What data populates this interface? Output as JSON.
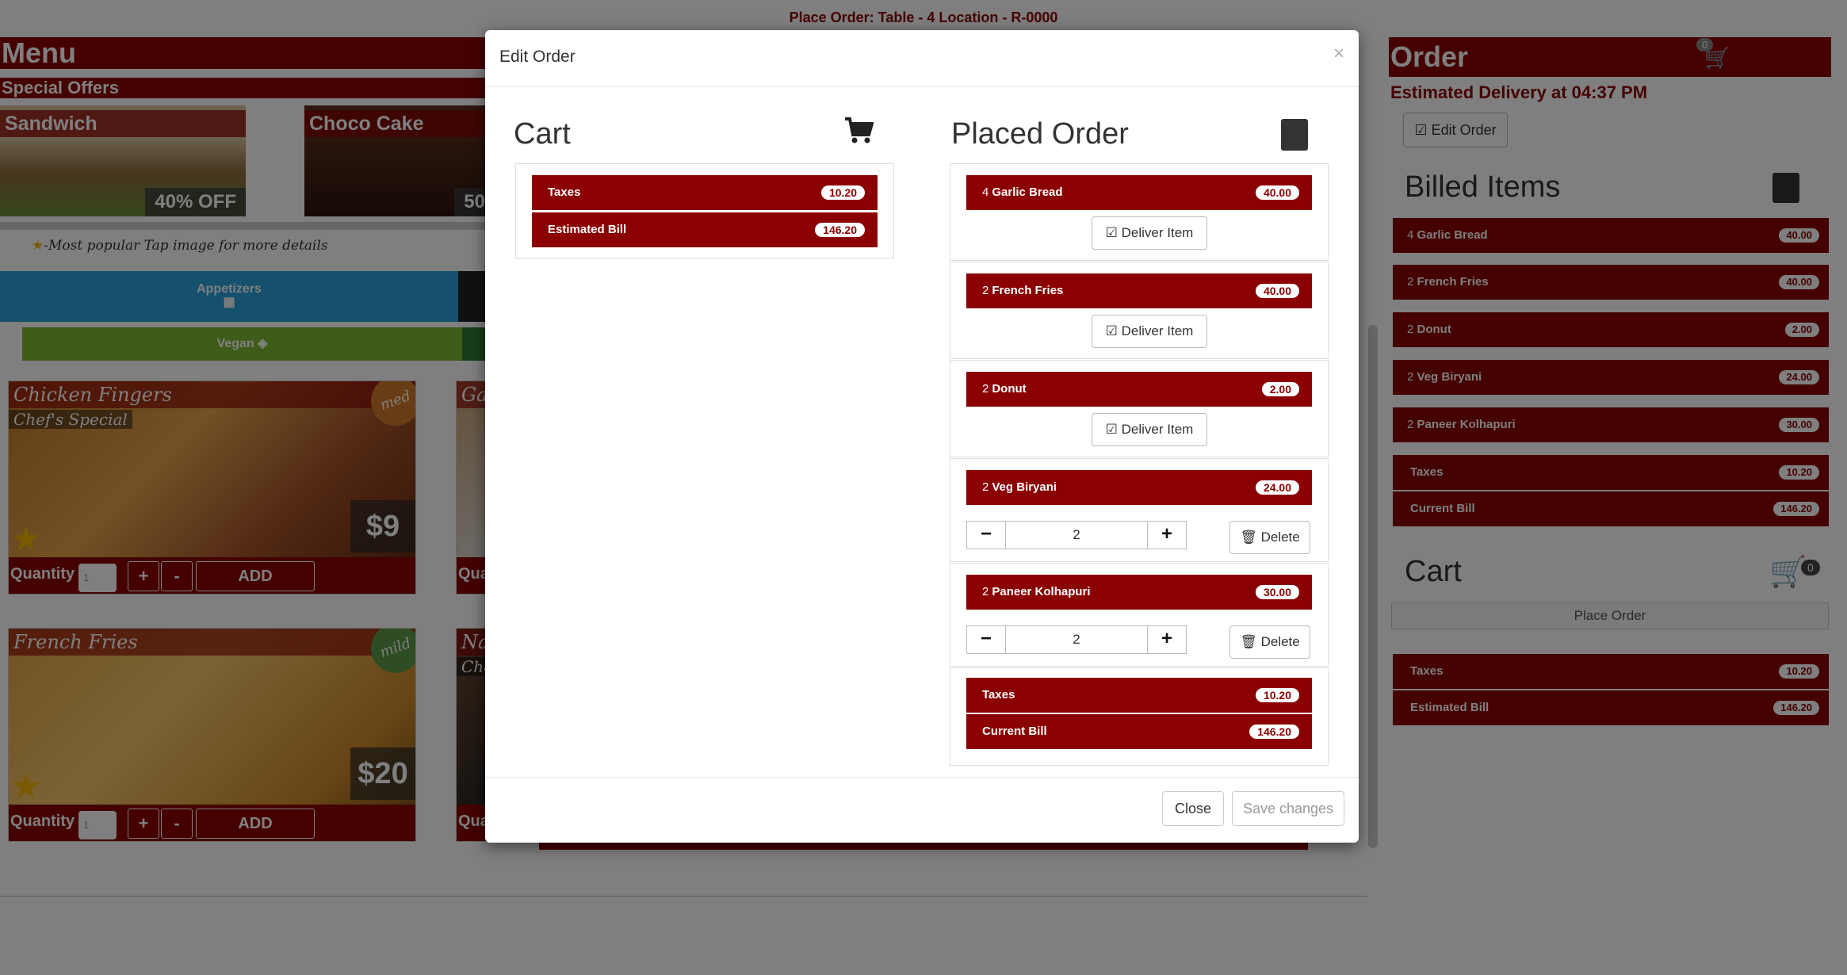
{
  "page": {
    "top_title": "Place Order: Table - 4 Location - R-0000"
  },
  "menu": {
    "title": "Menu",
    "special_offers_label": "Special Offers",
    "offers": [
      {
        "name": "Sandwich",
        "discount": "40% OFF"
      },
      {
        "name": "Choco Cake",
        "discount": "50"
      }
    ],
    "hint": "-Most popular   Tap image for more details",
    "category": "Appetizers",
    "filter": "Vegan",
    "items": [
      {
        "name": "Chicken Fingers",
        "subtitle": "Chef's Special",
        "price": "$9",
        "spice": "med",
        "qty_label": "Quantity",
        "qty_value": "1",
        "plus": "+",
        "minus": "-",
        "add": "ADD"
      },
      {
        "name": "French Fries",
        "subtitle": "",
        "price": "$20",
        "spice": "mild",
        "qty_label": "Quantity",
        "qty_value": "1",
        "plus": "+",
        "minus": "-",
        "add": "ADD"
      }
    ],
    "items_col2": [
      {
        "name": "Gar",
        "qty_label": "Qua"
      },
      {
        "name": "Na",
        "subtitle": "Chef",
        "qty_label": "Qua"
      }
    ]
  },
  "sidebar": {
    "title": "Order",
    "cart_count": "0",
    "estimated_delivery": "Estimated Delivery at 04:37 PM",
    "edit_order_label": "Edit Order",
    "billed_title": "Billed Items",
    "billed_items": [
      {
        "qty": "4",
        "name": "Garlic Bread",
        "amount": "40.00"
      },
      {
        "qty": "2",
        "name": "French Fries",
        "amount": "40.00"
      },
      {
        "qty": "2",
        "name": "Donut",
        "amount": "2.00"
      },
      {
        "qty": "2",
        "name": "Veg Biryani",
        "amount": "24.00"
      },
      {
        "qty": "2",
        "name": "Paneer Kolhapuri",
        "amount": "30.00"
      }
    ],
    "billed_totals": [
      {
        "label": "Taxes",
        "amount": "10.20"
      },
      {
        "label": "Current Bill",
        "amount": "146.20"
      }
    ],
    "cart_title": "Cart",
    "cart_badge": "0",
    "place_order_label": "Place Order",
    "cart_totals": [
      {
        "label": "Taxes",
        "amount": "10.20"
      },
      {
        "label": "Estimated Bill",
        "amount": "146.20"
      }
    ]
  },
  "modal": {
    "title": "Edit Order",
    "close_x": "×",
    "cart_title": "Cart",
    "placed_title": "Placed Order",
    "cart_rows": [
      {
        "label": "Taxes",
        "amount": "10.20"
      },
      {
        "label": "Estimated Bill",
        "amount": "146.20"
      }
    ],
    "placed_items": [
      {
        "qty": "4",
        "name": "Garlic Bread",
        "amount": "40.00",
        "action": "Deliver Item"
      },
      {
        "qty": "2",
        "name": "French Fries",
        "amount": "40.00",
        "action": "Deliver Item"
      },
      {
        "qty": "2",
        "name": "Donut",
        "amount": "2.00",
        "action": "Deliver Item"
      },
      {
        "qty": "2",
        "name": "Veg Biryani",
        "amount": "24.00",
        "minus": "−",
        "quantity": "2",
        "plus": "+",
        "delete": "Delete"
      },
      {
        "qty": "2",
        "name": "Paneer Kolhapuri",
        "amount": "30.00",
        "minus": "−",
        "quantity": "2",
        "plus": "+",
        "delete": "Delete"
      }
    ],
    "placed_totals": [
      {
        "label": "Taxes",
        "amount": "10.20"
      },
      {
        "label": "Current Bill",
        "amount": "146.20"
      }
    ],
    "close_label": "Close",
    "save_label": "Save changes"
  },
  "colors": {
    "accent": "#8b0000",
    "appetizers": "#2aa3d8",
    "vegan": "#7cb82f"
  }
}
